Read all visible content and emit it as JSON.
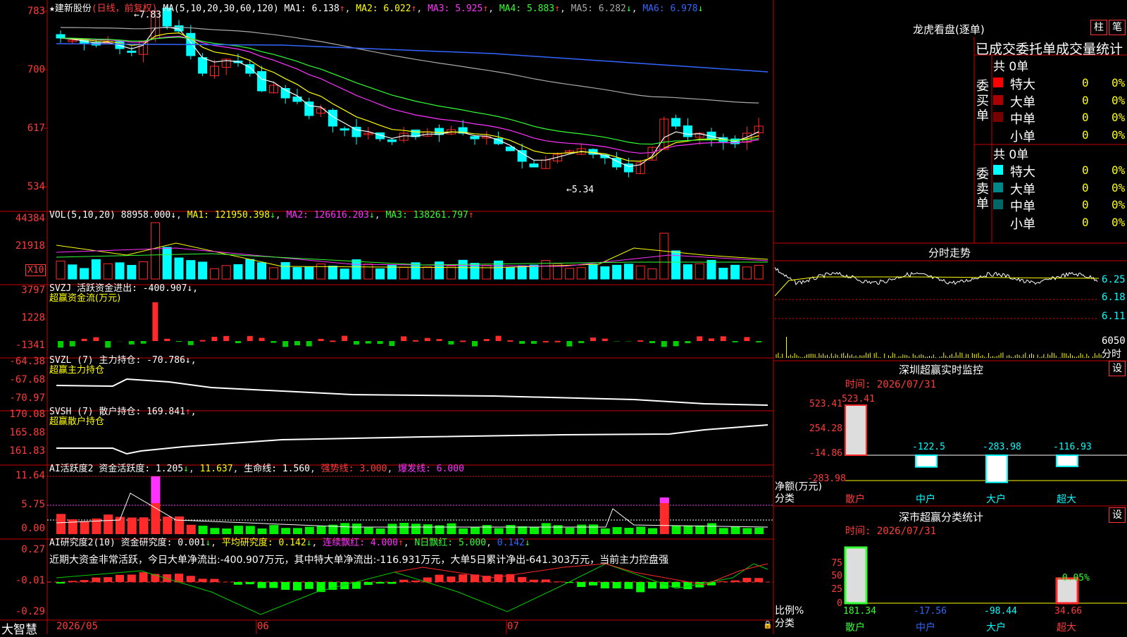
{
  "stock": {
    "name": "建新股份",
    "period": "(日线，前复权)",
    "high_mark": "7.83",
    "low_mark": "5.34"
  },
  "ma_header": {
    "params": "MA(5,10,20,30,60,120)",
    "items": [
      {
        "label": "MA1:",
        "value": "6.138",
        "arrow": "↑",
        "color": "#ffffff"
      },
      {
        "label": "MA2:",
        "value": "6.022",
        "arrow": "↑",
        "color": "#ffff00"
      },
      {
        "label": "MA3:",
        "value": "5.925",
        "arrow": "↑",
        "color": "#ff33ff"
      },
      {
        "label": "MA4:",
        "value": "5.883",
        "arrow": "↑",
        "color": "#33ff33"
      },
      {
        "label": "MA5:",
        "value": "6.282",
        "arrow": "↓",
        "color": "#aaaaaa"
      },
      {
        "label": "MA6:",
        "value": "6.978",
        "arrow": "↓",
        "color": "#3366ff"
      }
    ]
  },
  "price_axis": [
    "783",
    "700",
    "617",
    "534"
  ],
  "vol": {
    "header": "VOL(5,10,20)",
    "value": "88958.000",
    "arrow": "↓",
    "items": [
      {
        "label": "MA1:",
        "value": "121950.398",
        "arrow": "↓",
        "color": "#ffff00"
      },
      {
        "label": "MA2:",
        "value": "126616.203",
        "arrow": "↓",
        "color": "#ff33ff"
      },
      {
        "label": "MA3:",
        "value": "138261.797",
        "arrow": "↑",
        "color": "#33ff33"
      }
    ],
    "axis": [
      "44384",
      "21918"
    ],
    "unit": "X10"
  },
  "svzj": {
    "title": "SVZJ",
    "desc": "活跃资金进出:",
    "value": "-400.907",
    "arrow": "↓",
    "sub": "超赢资金流(万元)",
    "axis": [
      "3797",
      "1228",
      "-1341"
    ]
  },
  "svzl": {
    "title": "SVZL (7)",
    "desc": "主力持仓:",
    "value": "-70.786",
    "arrow": "↓",
    "sub": "超赢主力持仓",
    "axis": [
      "-64.38",
      "-67.68",
      "-70.97"
    ]
  },
  "svsh": {
    "title": "SVSH (7)",
    "desc": "散户持仓:",
    "value": "169.841",
    "arrow": "↑",
    "sub": "超赢散户持仓",
    "axis": [
      "170.08",
      "165.88",
      "161.83"
    ]
  },
  "ai1": {
    "title": "AI活跃度2",
    "desc": "资金活跃度:",
    "value": "1.205",
    "arrow": "↓",
    "v2": "11.637",
    "life": "生命线: 1.560",
    "strong": "强势线: 3.000",
    "burst": "爆发线: 6.000",
    "axis": [
      "11.64",
      "5.75",
      "0.00"
    ]
  },
  "ai2": {
    "title": "AI研究度2(10)",
    "desc": "资金研究度:",
    "value": "0.001",
    "arrow": "↓",
    "avg": "平均研究度: 0.142",
    "avg_arrow": "↓",
    "lian": "连续飘红: 4.000",
    "lian_arrow": "↑",
    "nday": "N日飘红: 5.000",
    "nday_val": "0.142",
    "nday_arrow": "↓",
    "comment": "近期大资金非常活跃，今日大单净流出:-400.907万元，其中特大单净流出:-116.931万元，大单5日累计净出-641.303万元，当前主力控盘强",
    "axis": [
      "0.27",
      "-0.01",
      "-0.29"
    ]
  },
  "xaxis": {
    "brand": "大智慧",
    "dates": [
      "2026/05",
      "06",
      "07"
    ]
  },
  "right": {
    "lhb": {
      "title": "龙虎看盘(逐单)",
      "btn1": "柱",
      "btn2": "笔",
      "subtitle": "已成交委托单成交量统计",
      "buy": {
        "side": "委买单",
        "total": "共 0单",
        "rows": [
          {
            "label": "特大",
            "count": "0",
            "pct": "0%",
            "color": "#ff0000"
          },
          {
            "label": "大单",
            "count": "0",
            "pct": "0%",
            "color": "#aa0000"
          },
          {
            "label": "中单",
            "count": "0",
            "pct": "0%",
            "color": "#770000"
          },
          {
            "label": "小单",
            "count": "0",
            "pct": "0%",
            "color": "#000000"
          }
        ]
      },
      "sell": {
        "side": "委卖单",
        "total": "共 0单",
        "rows": [
          {
            "label": "特大",
            "count": "0",
            "pct": "0%",
            "color": "#00ffff"
          },
          {
            "label": "大单",
            "count": "0",
            "pct": "0%",
            "color": "#008888"
          },
          {
            "label": "中单",
            "count": "0",
            "pct": "0%",
            "color": "#006666"
          },
          {
            "label": "小单",
            "count": "0",
            "pct": "0%",
            "color": "#000000"
          }
        ]
      }
    },
    "fenshi": {
      "title": "分时走势",
      "prices": [
        "6.25",
        "6.18",
        "6.11"
      ],
      "vol": "6050",
      "vol_unit": "分时"
    },
    "monitor": {
      "title": "深圳超赢实时监控",
      "btn": "设",
      "time": "时间: 2026/07/31",
      "axis": [
        "523.41",
        "254.28",
        "-14.86",
        "-283.98"
      ],
      "ylabel": "净额(万元)",
      "xlabel": "分类",
      "bars": [
        {
          "cat": "散户",
          "value": 523.41,
          "label": "523.41"
        },
        {
          "cat": "中户",
          "value": -122.5,
          "label": "-122.5"
        },
        {
          "cat": "大户",
          "value": -283.98,
          "label": "-283.98"
        },
        {
          "cat": "超大",
          "value": -116.93,
          "label": "-116.93"
        }
      ]
    },
    "classify": {
      "title": "深市超赢分类统计",
      "btn": "设",
      "time": "时间: 2026/07/31",
      "axis": [
        "75",
        "50",
        "25",
        "0"
      ],
      "ylabel": "比例%",
      "xlabel": "分类",
      "bars": [
        {
          "cat": "散户",
          "value": 181.34,
          "label": "181.34"
        },
        {
          "cat": "中户",
          "value": -17.56,
          "label": "-17.56"
        },
        {
          "cat": "大户",
          "value": -98.44,
          "label": "-98.44"
        },
        {
          "cat": "超大",
          "value": 34.66,
          "label": "34.66"
        }
      ],
      "note": "-0.05%"
    }
  }
}
